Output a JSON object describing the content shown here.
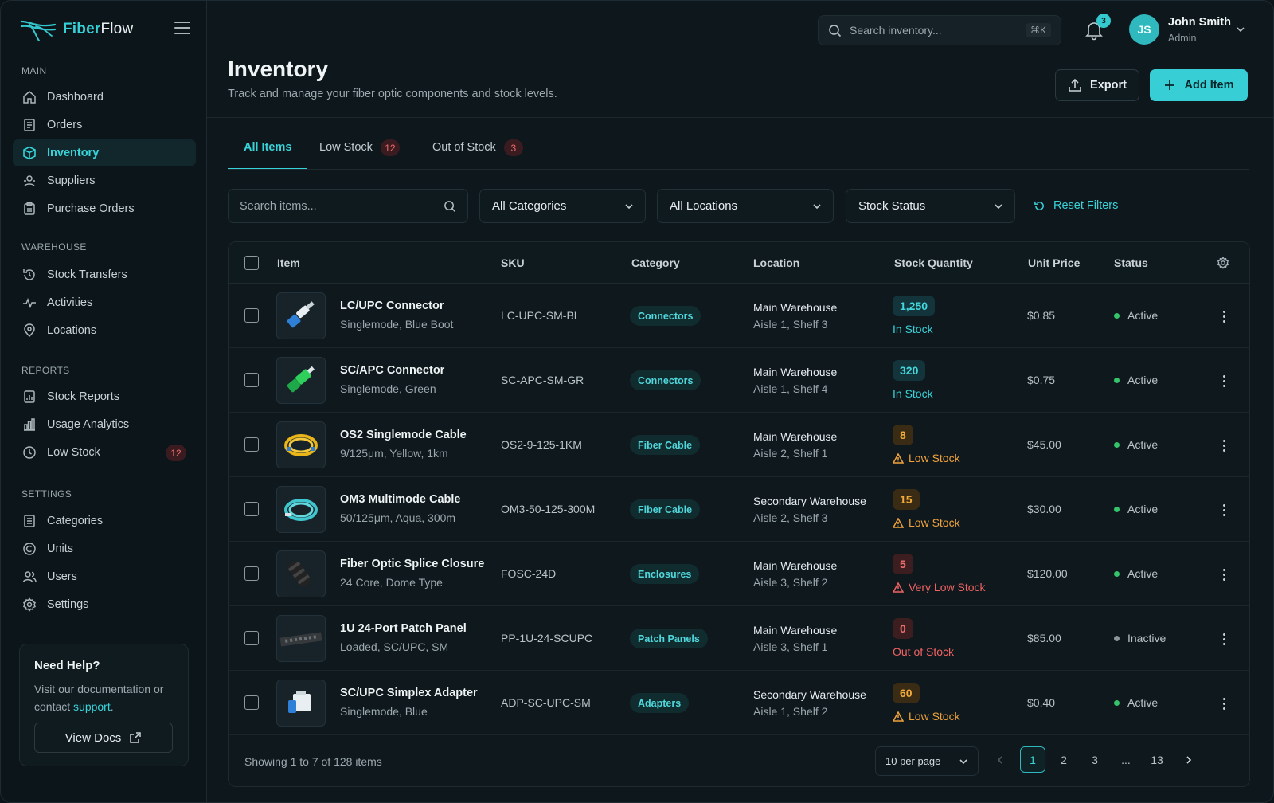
{
  "app": {
    "brand_a": "Fiber",
    "brand_b": "Flow"
  },
  "sidebar": {
    "sections": [
      {
        "title": "MAIN"
      },
      {
        "title": "WAREHOUSE"
      },
      {
        "title": "REPORTS"
      },
      {
        "title": "SETTINGS"
      }
    ],
    "items": [
      {
        "label": "Dashboard",
        "icon": "home-icon"
      },
      {
        "label": "Orders",
        "icon": "receipt-icon"
      },
      {
        "label": "Inventory",
        "icon": "box-icon",
        "active": true
      },
      {
        "label": "Suppliers",
        "icon": "suppliers-icon"
      },
      {
        "label": "Purchase Orders",
        "icon": "clipboard-icon"
      },
      {
        "label": "Stock Transfers",
        "icon": "transfer-icon"
      },
      {
        "label": "Activities",
        "icon": "activity-icon"
      },
      {
        "label": "Locations",
        "icon": "pin-icon"
      },
      {
        "label": "Stock Reports",
        "icon": "report-icon"
      },
      {
        "label": "Usage Analytics",
        "icon": "analytics-icon"
      },
      {
        "label": "Low Stock",
        "icon": "alert-clock-icon",
        "badge": "12"
      },
      {
        "label": "Categories",
        "icon": "categories-icon"
      },
      {
        "label": "Units",
        "icon": "units-icon"
      },
      {
        "label": "Users",
        "icon": "users-icon"
      },
      {
        "label": "Settings",
        "icon": "gear-icon"
      }
    ],
    "help": {
      "title": "Need Help?",
      "text_a": "Visit our documentation or",
      "text_b": "contact",
      "link": "support",
      "text_c": ".",
      "button": "View Docs"
    }
  },
  "topbar": {
    "search_placeholder": "Search inventory...",
    "shortcut": "⌘K",
    "notifications": "3",
    "user": {
      "initials": "JS",
      "name": "John Smith",
      "role": "Admin"
    }
  },
  "header": {
    "title": "Inventory",
    "subtitle": "Track and manage your fiber optic components and stock levels.",
    "export_label": "Export",
    "add_label": "Add Item"
  },
  "tabs": [
    {
      "label": "All Items",
      "active": true
    },
    {
      "label": "Low Stock",
      "badge": "12"
    },
    {
      "label": "Out of Stock",
      "badge": "3"
    }
  ],
  "filters": {
    "search_placeholder": "Search items...",
    "category": "All Categories",
    "location": "All Locations",
    "status": "Stock Status",
    "reset": "Reset Filters"
  },
  "table": {
    "columns": [
      "Item",
      "SKU",
      "Category",
      "Location",
      "Stock Quantity",
      "Unit Price",
      "Status"
    ],
    "rows": [
      {
        "name": "LC/UPC Connector",
        "desc": "Singlemode, Blue Boot",
        "sku": "LC-UPC-SM-BL",
        "category": "Connectors",
        "loc1": "Main Warehouse",
        "loc2": "Aisle 1, Shelf 3",
        "qty": "1,250",
        "qty_state": "ok",
        "stock_label": "In Stock",
        "price": "$0.85",
        "status": "Active",
        "thumb": "lc-connector"
      },
      {
        "name": "SC/APC Connector",
        "desc": "Singlemode, Green",
        "sku": "SC-APC-SM-GR",
        "category": "Connectors",
        "loc1": "Main Warehouse",
        "loc2": "Aisle 1, Shelf 4",
        "qty": "320",
        "qty_state": "ok",
        "stock_label": "In Stock",
        "price": "$0.75",
        "status": "Active",
        "thumb": "sc-connector"
      },
      {
        "name": "OS2 Singlemode Cable",
        "desc": "9/125μm, Yellow, 1km",
        "sku": "OS2-9-125-1KM",
        "category": "Fiber Cable",
        "loc1": "Main Warehouse",
        "loc2": "Aisle 2, Shelf 1",
        "qty": "8",
        "qty_state": "low",
        "stock_label": "Low Stock",
        "price": "$45.00",
        "status": "Active",
        "thumb": "yellow-cable"
      },
      {
        "name": "OM3 Multimode Cable",
        "desc": "50/125μm, Aqua, 300m",
        "sku": "OM3-50-125-300M",
        "category": "Fiber Cable",
        "loc1": "Secondary Warehouse",
        "loc2": "Aisle 2, Shelf 3",
        "qty": "15",
        "qty_state": "low",
        "stock_label": "Low Stock",
        "price": "$30.00",
        "status": "Active",
        "thumb": "aqua-cable"
      },
      {
        "name": "Fiber Optic Splice Closure",
        "desc": "24 Core, Dome Type",
        "sku": "FOSC-24D",
        "category": "Enclosures",
        "loc1": "Main Warehouse",
        "loc2": "Aisle 3, Shelf 2",
        "qty": "5",
        "qty_state": "verylow",
        "stock_label": "Very Low Stock",
        "price": "$120.00",
        "status": "Active",
        "thumb": "closure"
      },
      {
        "name": "1U 24-Port Patch Panel",
        "desc": "Loaded, SC/UPC, SM",
        "sku": "PP-1U-24-SCUPC",
        "category": "Patch Panels",
        "loc1": "Main Warehouse",
        "loc2": "Aisle 3, Shelf 1",
        "qty": "0",
        "qty_state": "out",
        "stock_label": "Out of Stock",
        "price": "$85.00",
        "status": "Inactive",
        "thumb": "patch-panel"
      },
      {
        "name": "SC/UPC Simplex Adapter",
        "desc": "Singlemode, Blue",
        "sku": "ADP-SC-UPC-SM",
        "category": "Adapters",
        "loc1": "Secondary Warehouse",
        "loc2": "Aisle 1, Shelf 2",
        "qty": "60",
        "qty_state": "low",
        "stock_label": "Low Stock",
        "price": "$0.40",
        "status": "Active",
        "thumb": "adapter"
      }
    ],
    "footer": {
      "showing": "Showing 1 to 7 of 128 items",
      "per_page": "10 per page",
      "pages": [
        "1",
        "2",
        "3",
        "...",
        "13"
      ]
    }
  },
  "colors": {
    "accent": "#38d3d9",
    "low": "#f0a23a",
    "danger": "#ef6262",
    "ok": "#38d3d9",
    "active_dot": "#35c46a"
  }
}
